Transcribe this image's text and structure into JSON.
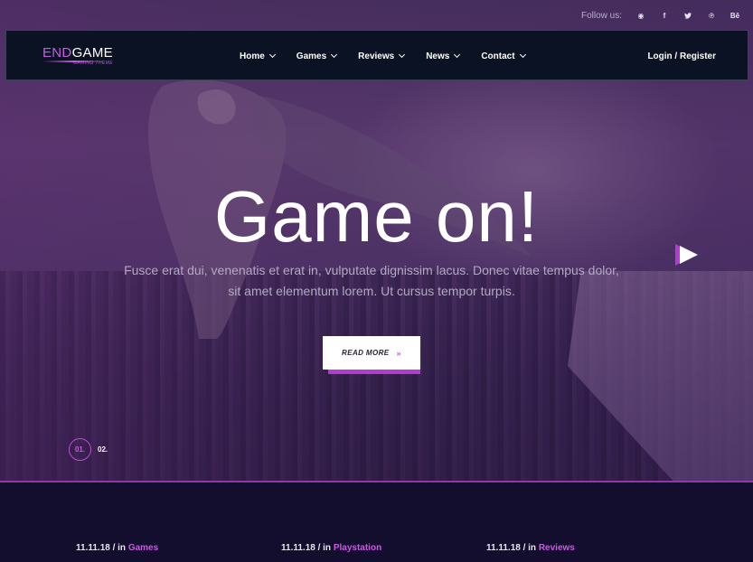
{
  "follow": {
    "label": "Follow us:",
    "icons": [
      {
        "name": "dribbble-icon",
        "glyph": "◉"
      },
      {
        "name": "facebook-icon",
        "glyph": "f"
      },
      {
        "name": "twitter-icon",
        "glyph": "🐦"
      },
      {
        "name": "pinterest-icon",
        "glyph": "℗"
      },
      {
        "name": "behance-icon",
        "glyph": "Bē"
      }
    ]
  },
  "logo": {
    "part1": "END",
    "part2": "GAME",
    "sub": "GAMING THEME"
  },
  "nav": {
    "items": [
      {
        "label": "Home"
      },
      {
        "label": "Games"
      },
      {
        "label": "Reviews"
      },
      {
        "label": "News"
      },
      {
        "label": "Contact"
      }
    ],
    "login": "Login / Register"
  },
  "hero": {
    "title": "Game on!",
    "text_line1": "Fusce erat dui, venenatis et erat in, vulputate dignissim lacus. Donec vitae tempus dolor,",
    "text_line2": "sit amet elementum lorem. Ut cursus tempor turpis.",
    "button": "READ MORE",
    "button_arrows": "»",
    "pager": [
      "01.",
      "02."
    ]
  },
  "posts": [
    {
      "date": "11.11.18 / in ",
      "category": "Games"
    },
    {
      "date": "11.11.18 / in ",
      "category": "Playstation"
    },
    {
      "date": "11.11.18 / in ",
      "category": "Reviews"
    }
  ],
  "colors": {
    "accent": "#c55ce0",
    "nav_bg": "#0b1224",
    "footer_bg": "#130e2d"
  }
}
